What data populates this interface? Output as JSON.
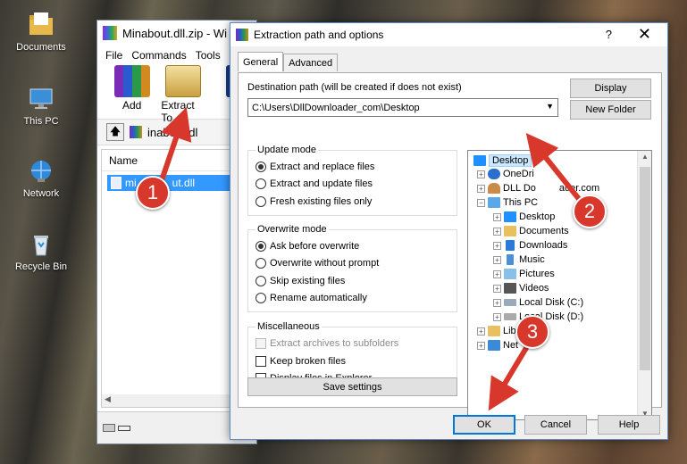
{
  "desktop": {
    "icons": [
      {
        "label": "Documents",
        "icon": "folder-icon"
      },
      {
        "label": "This PC",
        "icon": "computer-icon"
      },
      {
        "label": "Network",
        "icon": "network-icon"
      },
      {
        "label": "Recycle Bin",
        "icon": "recycle-bin-icon"
      }
    ]
  },
  "winrar": {
    "title": "Minabout.dll.zip - Wi",
    "menu": [
      "File",
      "Commands",
      "Tools"
    ],
    "toolbar": {
      "add": "Add",
      "extract_to": "Extract To"
    },
    "address": "inabout.dl",
    "column_name": "Name",
    "file": "minabout.dll",
    "file_visible_prefix": "mi",
    "file_visible_suffix": "ut.dll"
  },
  "dialog": {
    "title": "Extraction path and options",
    "help": "?",
    "close": "✕",
    "tabs": [
      "General",
      "Advanced"
    ],
    "destination_label": "Destination path (will be created if does not exist)",
    "destination_value": "C:\\Users\\DllDownloader_com\\Desktop",
    "display_button": "Display",
    "new_folder_button": "New Folder",
    "update_mode": {
      "title": "Update mode",
      "options": [
        "Extract and replace files",
        "Extract and update files",
        "Fresh existing files only"
      ],
      "selected": 0
    },
    "overwrite_mode": {
      "title": "Overwrite mode",
      "options": [
        "Ask before overwrite",
        "Overwrite without prompt",
        "Skip existing files",
        "Rename automatically"
      ],
      "selected": 0
    },
    "misc": {
      "title": "Miscellaneous",
      "options": [
        {
          "label": "Extract archives to subfolders",
          "checked": false,
          "disabled": true
        },
        {
          "label": "Keep broken files",
          "checked": false,
          "disabled": false
        },
        {
          "label": "Display files in Explorer",
          "checked": false,
          "disabled": false
        }
      ]
    },
    "save_settings": "Save settings",
    "tree": {
      "desktop": "Desktop",
      "onedrive": "OneDri",
      "user": "DLL Do",
      "user_tail": "ader.com",
      "this_pc": "This PC",
      "pc_children": [
        "Desktop",
        "Documents",
        "Downloads",
        "Music",
        "Pictures",
        "Videos",
        "Local Disk (C:)",
        "Local Disk (D:)"
      ],
      "libraries": "Libraries",
      "network": "Net"
    },
    "buttons": {
      "ok": "OK",
      "cancel": "Cancel",
      "help": "Help"
    }
  },
  "annotations": [
    "1",
    "2",
    "3"
  ],
  "colors": {
    "accent": "#0078d7",
    "badge": "#d8382c",
    "selection": "#3399ff"
  }
}
